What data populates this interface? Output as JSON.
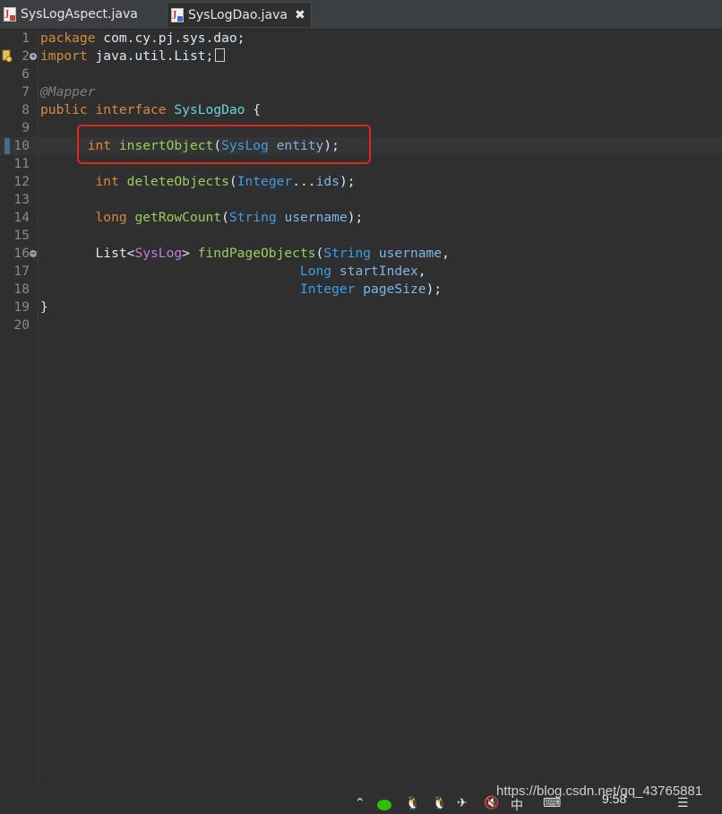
{
  "tabs": [
    {
      "label": "SysLogAspect.java",
      "active": false
    },
    {
      "label": "SysLogDao.java",
      "active": true,
      "close": "✖"
    }
  ],
  "lines": [
    {
      "n": "1",
      "tokens": [
        [
          "kw",
          "package"
        ],
        [
          "plain",
          " com.cy.pj.sys.dao;"
        ]
      ]
    },
    {
      "n": "2",
      "tokens": [
        [
          "kw",
          "import"
        ],
        [
          "plain",
          " java.util.List;"
        ]
      ],
      "fold": "plus",
      "bookmark": true,
      "box": true
    },
    {
      "n": "6",
      "tokens": []
    },
    {
      "n": "7",
      "tokens": [
        [
          "ann",
          "@Mapper"
        ]
      ]
    },
    {
      "n": "8",
      "tokens": [
        [
          "kw",
          "public"
        ],
        [
          "plain",
          " "
        ],
        [
          "kw",
          "interface"
        ],
        [
          "plain",
          " "
        ],
        [
          "iface",
          "SysLogDao"
        ],
        [
          "plain",
          " {"
        ]
      ]
    },
    {
      "n": "9",
      "tokens": []
    },
    {
      "n": "10",
      "tokens": [
        [
          "plain",
          "      "
        ],
        [
          "kw",
          "int"
        ],
        [
          "plain",
          " "
        ],
        [
          "meth",
          "insertObject"
        ],
        [
          "plain",
          "("
        ],
        [
          "typ",
          "SysLog"
        ],
        [
          "plain",
          " "
        ],
        [
          "param",
          "entity"
        ],
        [
          "plain",
          ");"
        ]
      ],
      "current": true,
      "marker": true
    },
    {
      "n": "11",
      "tokens": []
    },
    {
      "n": "12",
      "tokens": [
        [
          "plain",
          "       "
        ],
        [
          "kw",
          "int"
        ],
        [
          "plain",
          " "
        ],
        [
          "meth",
          "deleteObjects"
        ],
        [
          "plain",
          "("
        ],
        [
          "typ",
          "Integer"
        ],
        [
          "plain",
          "..."
        ],
        [
          "param",
          "ids"
        ],
        [
          "plain",
          ");"
        ]
      ]
    },
    {
      "n": "13",
      "tokens": []
    },
    {
      "n": "14",
      "tokens": [
        [
          "plain",
          "       "
        ],
        [
          "kw",
          "long"
        ],
        [
          "plain",
          " "
        ],
        [
          "meth",
          "getRowCount"
        ],
        [
          "plain",
          "("
        ],
        [
          "typ",
          "String"
        ],
        [
          "plain",
          " "
        ],
        [
          "param",
          "username"
        ],
        [
          "plain",
          ");"
        ]
      ]
    },
    {
      "n": "15",
      "tokens": []
    },
    {
      "n": "16",
      "tokens": [
        [
          "plain",
          "       List<"
        ],
        [
          "gen",
          "SysLog"
        ],
        [
          "plain",
          "> "
        ],
        [
          "meth",
          "findPageObjects"
        ],
        [
          "plain",
          "("
        ],
        [
          "typ",
          "String"
        ],
        [
          "plain",
          " "
        ],
        [
          "param",
          "username"
        ],
        [
          "plain",
          ","
        ]
      ],
      "fold": "minus"
    },
    {
      "n": "17",
      "tokens": [
        [
          "plain",
          "                                 "
        ],
        [
          "typ",
          "Long"
        ],
        [
          "plain",
          " "
        ],
        [
          "param",
          "startIndex"
        ],
        [
          "plain",
          ","
        ]
      ]
    },
    {
      "n": "18",
      "tokens": [
        [
          "plain",
          "                                 "
        ],
        [
          "typ",
          "Integer"
        ],
        [
          "plain",
          " "
        ],
        [
          "param",
          "pageSize"
        ],
        [
          "plain",
          ");"
        ]
      ]
    },
    {
      "n": "19",
      "tokens": [
        [
          "plain",
          "}"
        ]
      ]
    },
    {
      "n": "20",
      "tokens": []
    }
  ],
  "watermark": "https://blog.csdn.net/qq_43765881",
  "clock": "9:58",
  "tray": {
    "ime": "中"
  },
  "colors": {
    "keyword": "#d88a3a",
    "type": "#3d9ee8",
    "interface": "#67d2dc",
    "method": "#9bce5c",
    "parameter": "#7fb6ea",
    "annotation": "#808080",
    "highlight_box": "#e0251c"
  }
}
